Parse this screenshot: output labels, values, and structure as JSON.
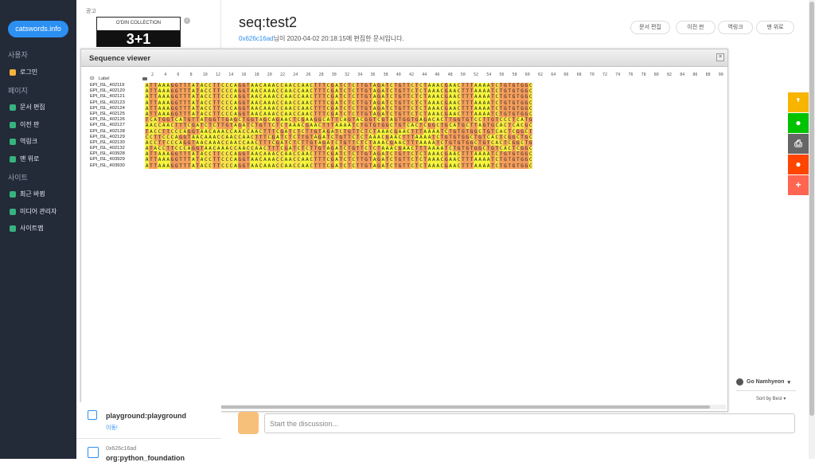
{
  "sidebar": {
    "brand": "catswords.info",
    "sections": {
      "user": "사용자",
      "page": "페이지",
      "site": "사이트"
    },
    "user_items": [
      {
        "label": "로그인",
        "color": "#f3b33d"
      }
    ],
    "page_items": [
      {
        "label": "문서 편집"
      },
      {
        "label": "이전 판"
      },
      {
        "label": "역링크"
      },
      {
        "label": "맨 위로"
      }
    ],
    "site_items": [
      {
        "label": "최근 바뀜"
      },
      {
        "label": "미디어 관리자"
      },
      {
        "label": "사이트맵"
      }
    ]
  },
  "ad": {
    "label": "광고",
    "top_text": "O'DIN COLLECTION",
    "big_text": "3+1",
    "info_icon": "info-icon"
  },
  "page": {
    "title": "seq:test2",
    "meta_user": "0x626c16ad",
    "meta_rest": "님이 2020-04-02 20:18:15에 편집한 문서입니다.",
    "buttons": [
      "문서 편집",
      "이전 판",
      "역링크",
      "맨 위로"
    ]
  },
  "share_buttons": [
    {
      "name": "kakaostory-icon",
      "color": "#f7b500",
      "glyph": "❜"
    },
    {
      "name": "line-icon",
      "color": "#00c300",
      "glyph": "●"
    },
    {
      "name": "print-icon",
      "color": "#666666",
      "glyph": "⎙"
    },
    {
      "name": "reddit-icon",
      "color": "#ff4500",
      "glyph": "●"
    },
    {
      "name": "plus-icon",
      "color": "#ff6550",
      "glyph": "+"
    }
  ],
  "viewer": {
    "title": "Sequence viewer",
    "close": "×",
    "header_id": "ID",
    "header_label": "Label",
    "ruler": [
      "2",
      "4",
      "6",
      "8",
      "10",
      "12",
      "14",
      "16",
      "18",
      "20",
      "22",
      "24",
      "26",
      "28",
      "30",
      "32",
      "34",
      "36",
      "38",
      "40",
      "42",
      "44",
      "46",
      "48",
      "50",
      "52",
      "54",
      "56",
      "58",
      "60",
      "62",
      "64",
      "66",
      "68",
      "70",
      "72",
      "74",
      "76",
      "78",
      "80",
      "82",
      "84",
      "86",
      "88",
      "90"
    ],
    "rows": [
      {
        "id": "EPI_ISL_402119",
        "seq": "ATTAAAGGTTTATACCTTCCCAGGTAACAAACCAACCAACTTTCGATCTCTTGTAGATCTGTTCTCTAAACGAACTTTAAAATCTGTGTGGC"
      },
      {
        "id": "EPI_ISL_402120",
        "seq": "ATTAAAGGTTTATACCTTCCCAGGTAACAAACCAACCAACTTTCGATCTCTTGTAGATCTGTTCTCTAAACGAACTTTAAAATCTGTGTGGC"
      },
      {
        "id": "EPI_ISL_402121",
        "seq": "ATTAAAGGTTTATACCTTCCCAGGTAACAAACCAACCAACTTTCGATCTCTTGTAGATCTGTTCTCTAAACGAACTTTAAAATCTGTGTGGC"
      },
      {
        "id": "EPI_ISL_402123",
        "seq": "ATTAAAGGTTTATACCTTCCCAGGTAACAAACCAACCAACTTTCGATCTCTTGTAGATCTGTTCTCTAAACGAACTTTAAAATCTGTGTGGC"
      },
      {
        "id": "EPI_ISL_402124",
        "seq": "ATTAAAGGTTTATACCTTCCCAGGTAACAAACCAACCAACTTTCGATCTCTTGTAGATCTGTTCTCTAAACGAACTTTAAAATCTGTGTGGC"
      },
      {
        "id": "EPI_ISL_402125",
        "seq": "ATTAAAGGTTTATACCTTCCCAGGTAACAAACCAACCAACTTTCGATCTCTTGTAGATCTGTTCTCTAAACGAACTTTAAAATCTGTGTGGC"
      },
      {
        "id": "EPI_ISL_402126",
        "seq": "TCATGGTCATGTTATGGTTGAGCTGGTAGCAGAACTCGAAGGCATTCAGTACGGTCGTAGTGGTGAGACACTTGGTGTCCTTGTCCCTCATG"
      },
      {
        "id": "EPI_ISL_402127",
        "seq": "AACCAACTTTCGATCTCTTGTAGATCTGTTCTCTAAACGAACTTTAAAATCTGTGTGGCTGTCACTCGGCTGCATGCTTAGTGCACTCACGC"
      },
      {
        "id": "EPI_ISL_402128",
        "seq": "TACCTTCCCAGGTAACAAACCAACCAACTTTCGATCTCTTGTAGATCTGTTCTCTAAACGAACTTTAAAATCTGTGTGGCTGTCACTCGGCT"
      },
      {
        "id": "EPI_ISL_402129",
        "seq": "CCTTCCCAGGTAACAAACCAACCAACTTTCGATCTCTTGTAGATCTGTTCTCTAAACGAACTTTAAAATCTGTGTGGCTGTCACTCGGCTGC"
      },
      {
        "id": "EPI_ISL_402130",
        "seq": "ACCTTCCCAGGTAACAAACCAACCAACTTTCGATCTCTTGTAGATCTGTTCTCTAAACGAACTTTAAAATCTGTGTGGCTGTCACTCGGCTG"
      },
      {
        "id": "EPI_ISL_402132",
        "seq": "ATACCTTCCCAGGTAACAAACCAACCAACTTTCGATCTCTTGTAGATCTGTTCTCTAAACGAACTTTAAAATCTGTGTGGCTGTCACTCGGC"
      },
      {
        "id": "EPI_ISL_403928",
        "seq": "ATTAAAGGTTTATACCTTCCCAGGTAACAAACCAACCAACTTTCGATCTCTTGTAGATCTGTTCTCTAAACGAACTTTAAAATCTGTGTGGC"
      },
      {
        "id": "EPI_ISL_403929",
        "seq": "ATTAAAGGTTTATACCTTCCCAGGTAACAAACCAACCAACTTTCGATCTCTTGTAGATCTGTTCTCTAAACGAACTTTAAAATCTGTGTGGC"
      },
      {
        "id": "EPI_ISL_403930",
        "seq": "ATTAAAGGTTTATACCTTCCCAGGTAACAAACCAACCAACTTTCGATCTCTTGTAGATCTGTTCTCTAAACGAACTTTAAAATCTGTGTGGC"
      }
    ],
    "base_colors": {
      "A": "#f5f53c",
      "T": "#f5a15c",
      "G": "#f39a5c",
      "C": "#f7e14a"
    }
  },
  "sidebar_list": {
    "item1_title": "playground:playground",
    "item1_sub": "이동!",
    "item2_user": "0x626c16ad",
    "item2_title": "org:python_foundation"
  },
  "discussion": {
    "placeholder": "Start the discussion...",
    "user": "Go Namhyeon",
    "sort": "Sort by Best"
  }
}
